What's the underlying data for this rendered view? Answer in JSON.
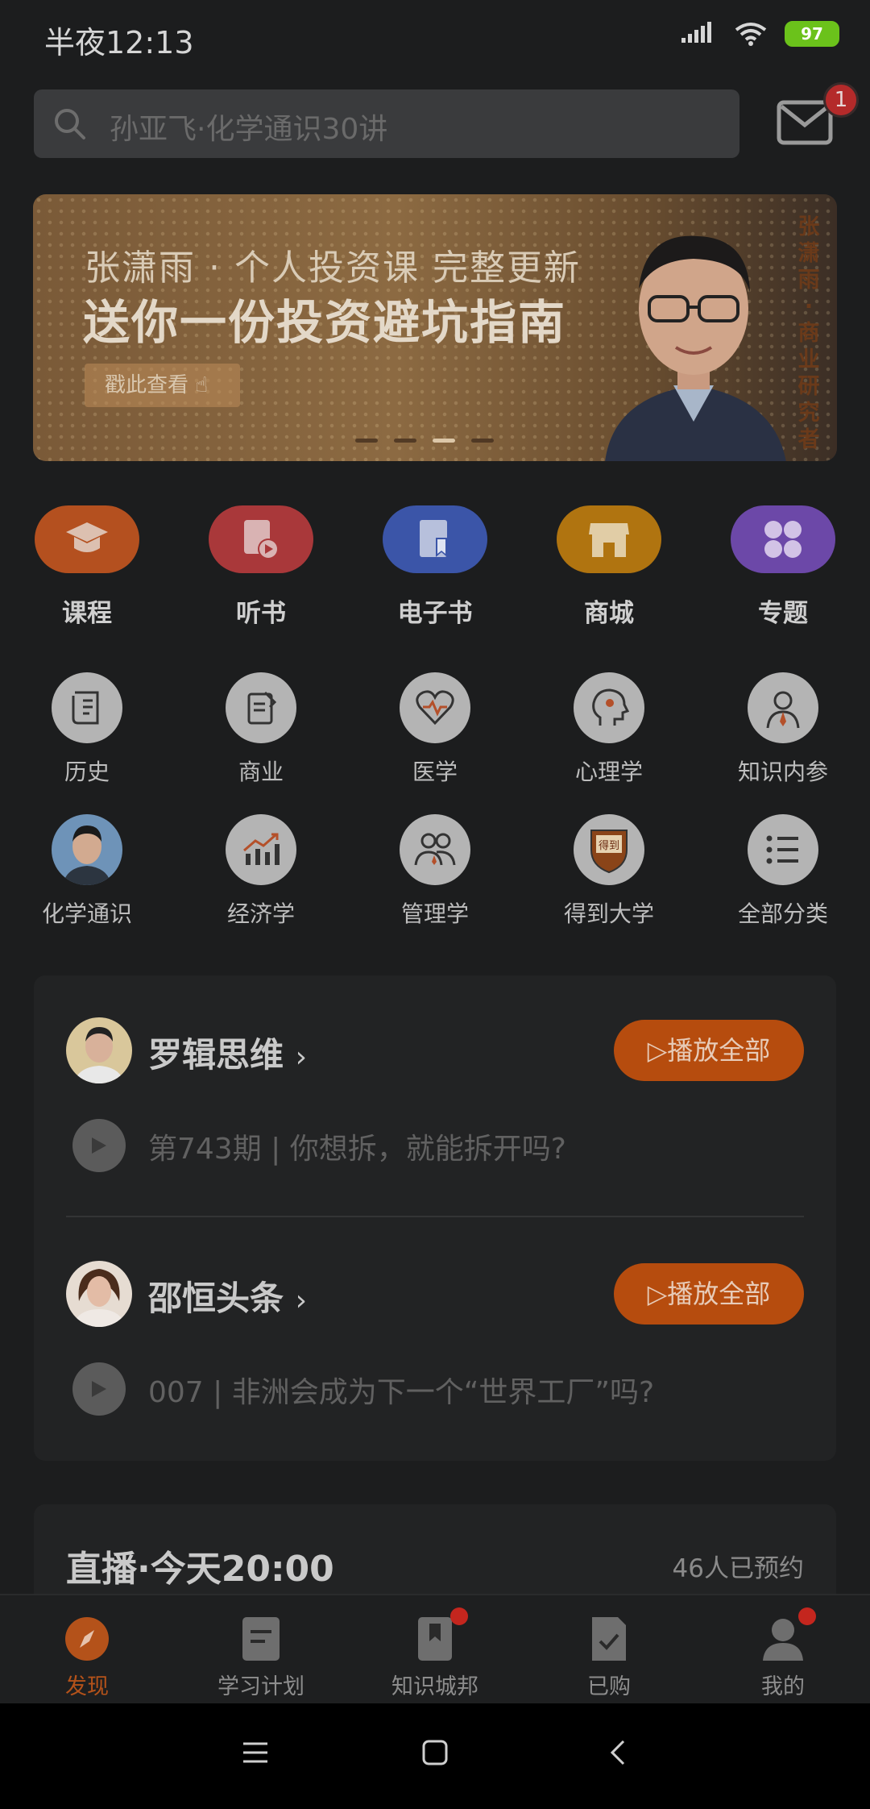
{
  "status_bar": {
    "time": "半夜12:13",
    "battery": "97"
  },
  "search": {
    "placeholder": "孙亚飞·化学通识30讲"
  },
  "mail": {
    "badge": "1"
  },
  "banner": {
    "line1": "张潇雨 · 个人投资课 完整更新",
    "line2": "送你一份投资避坑指南",
    "button": "戳此查看",
    "vertical_text": "张潇雨·商业研究者",
    "pages": 4,
    "active_page": 3
  },
  "main_nav": [
    {
      "label": "课程",
      "icon": "graduation-cap-icon",
      "color": "#b4501f"
    },
    {
      "label": "听书",
      "icon": "book-play-icon",
      "color": "#a9383a"
    },
    {
      "label": "电子书",
      "icon": "ebook-bookmark-icon",
      "color": "#3b55a8"
    },
    {
      "label": "商城",
      "icon": "store-icon",
      "color": "#b07410"
    },
    {
      "label": "专题",
      "icon": "grid-icon",
      "color": "#6c48a8"
    }
  ],
  "categories": [
    {
      "label": "历史",
      "icon": "scroll-icon"
    },
    {
      "label": "商业",
      "icon": "notepad-icon"
    },
    {
      "label": "医学",
      "icon": "heart-pulse-icon"
    },
    {
      "label": "心理学",
      "icon": "head-gear-icon"
    },
    {
      "label": "知识内参",
      "icon": "person-tie-icon"
    },
    {
      "label": "化学通识",
      "icon": "person-avatar-icon"
    },
    {
      "label": "经济学",
      "icon": "bar-chart-up-icon"
    },
    {
      "label": "管理学",
      "icon": "people-icon"
    },
    {
      "label": "得到大学",
      "icon": "shield-crest-icon"
    },
    {
      "label": "全部分类",
      "icon": "list-icon"
    }
  ],
  "audio_feeds": [
    {
      "title": "罗辑思维",
      "play_all": "播放全部",
      "episode": "第743期 | 你想拆，就能拆开吗?"
    },
    {
      "title": "邵恒头条",
      "play_all": "播放全部",
      "episode": "007 | 非洲会成为下一个“世界工厂”吗?"
    }
  ],
  "live": {
    "title": "直播·今天20:00",
    "count": "46人已预约"
  },
  "tabs": [
    {
      "label": "发现",
      "icon": "compass-icon",
      "active": true
    },
    {
      "label": "学习计划",
      "icon": "plan-doc-icon",
      "badge": false
    },
    {
      "label": "知识城邦",
      "icon": "bookmark-icon",
      "badge": true
    },
    {
      "label": "已购",
      "icon": "checked-doc-icon",
      "badge": false
    },
    {
      "label": "我的",
      "icon": "user-icon",
      "badge": true
    }
  ]
}
